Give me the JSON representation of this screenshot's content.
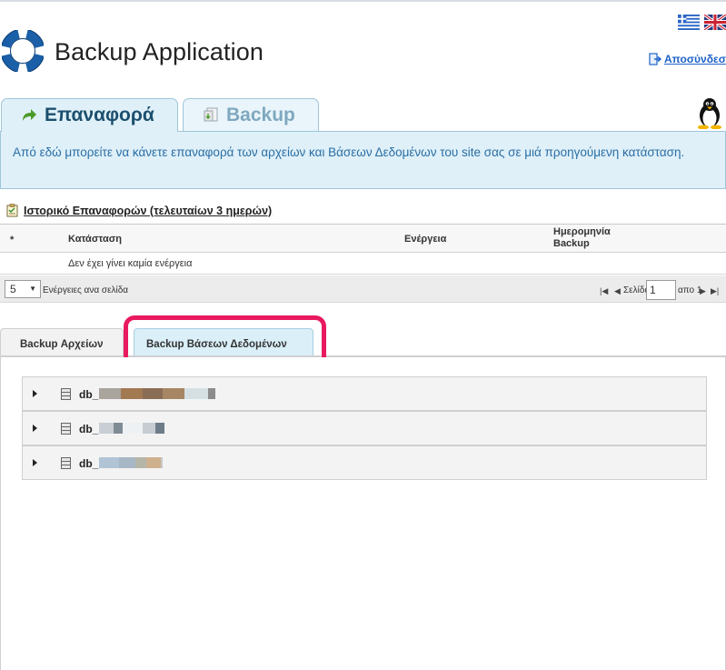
{
  "header": {
    "app_title": "Backup Application",
    "logout_label": "Αποσύνδεση",
    "languages": [
      "greek-flag-icon",
      "uk-flag-icon"
    ]
  },
  "main_tabs": [
    {
      "label": "Επαναφορά",
      "icon": "restore-arrow-icon",
      "active": true
    },
    {
      "label": "Backup",
      "icon": "backup-icon",
      "active": false
    }
  ],
  "info_text": "Από εδώ μπορείτε να κάνετε επαναφορά των αρχείων και Βάσεων Δεδομένων του site σας σε μιά προηγούμενη κατάσταση.",
  "history": {
    "title": "Ιστορικό Επαναφορών (τελευταίων 3 ημερών)",
    "columns": [
      "*",
      "Κατάσταση",
      "Ενέργεια",
      "Ημερομηνία\nBackup"
    ],
    "empty_message": "Δεν έχει γίνει καμία ενέργεια"
  },
  "pager": {
    "per_page_value": "5",
    "per_page_label": "Ενέργειες ανα σελίδα",
    "page_label": "Σελίδα",
    "page_value": "1",
    "page_of": "απο 1"
  },
  "sub_tabs": [
    {
      "label": "Backup Αρχείων",
      "active": false
    },
    {
      "label": "Backup Βάσεων Δεδομένων",
      "active": true
    }
  ],
  "databases": [
    {
      "prefix": "db_"
    },
    {
      "prefix": "db_"
    },
    {
      "prefix": "db_"
    }
  ],
  "colors": {
    "accent_blue": "#1f63c9",
    "panel_bg": "#dff0f8",
    "highlight": "#e8195f"
  }
}
